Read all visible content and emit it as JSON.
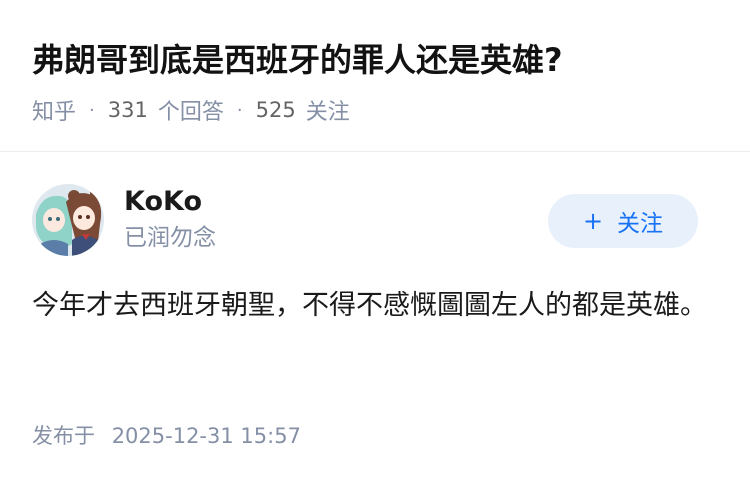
{
  "question": {
    "title": "弗朗哥到底是西班牙的罪人还是英雄?",
    "meta": {
      "source": "知乎",
      "answer_count": "331",
      "answer_label": "个回答",
      "follower_count": "525",
      "follower_label": "关注"
    }
  },
  "answer": {
    "author": {
      "name": "KoKo",
      "bio": "已润勿念",
      "avatar_icon": "anime-avatar"
    },
    "follow_button": {
      "icon": "plus-icon",
      "label": "关注"
    },
    "content": "今年才去西班牙朝聖，不得不感慨圖圖左人的都是英雄。",
    "publish": {
      "label": "发布于",
      "time": "2025-12-31 15:57"
    }
  },
  "colors": {
    "accent": "#1772f6",
    "follow_bg": "#e8f1fb",
    "meta_text": "#8590a6",
    "title_text": "#121212"
  }
}
